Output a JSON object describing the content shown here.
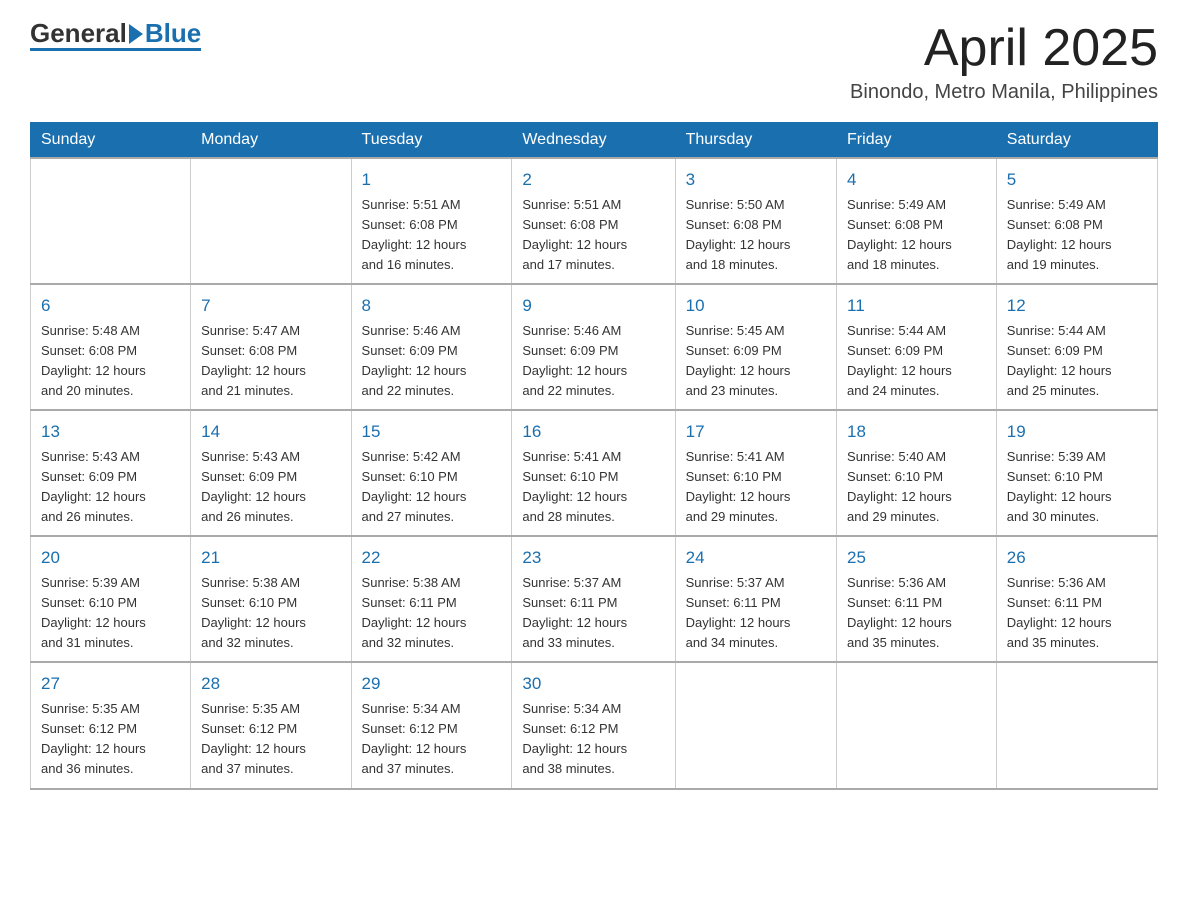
{
  "header": {
    "logo_general": "General",
    "logo_blue": "Blue",
    "title": "April 2025",
    "subtitle": "Binondo, Metro Manila, Philippines"
  },
  "weekdays": [
    "Sunday",
    "Monday",
    "Tuesday",
    "Wednesday",
    "Thursday",
    "Friday",
    "Saturday"
  ],
  "weeks": [
    [
      {
        "day": "",
        "detail": ""
      },
      {
        "day": "",
        "detail": ""
      },
      {
        "day": "1",
        "detail": "Sunrise: 5:51 AM\nSunset: 6:08 PM\nDaylight: 12 hours\nand 16 minutes."
      },
      {
        "day": "2",
        "detail": "Sunrise: 5:51 AM\nSunset: 6:08 PM\nDaylight: 12 hours\nand 17 minutes."
      },
      {
        "day": "3",
        "detail": "Sunrise: 5:50 AM\nSunset: 6:08 PM\nDaylight: 12 hours\nand 18 minutes."
      },
      {
        "day": "4",
        "detail": "Sunrise: 5:49 AM\nSunset: 6:08 PM\nDaylight: 12 hours\nand 18 minutes."
      },
      {
        "day": "5",
        "detail": "Sunrise: 5:49 AM\nSunset: 6:08 PM\nDaylight: 12 hours\nand 19 minutes."
      }
    ],
    [
      {
        "day": "6",
        "detail": "Sunrise: 5:48 AM\nSunset: 6:08 PM\nDaylight: 12 hours\nand 20 minutes."
      },
      {
        "day": "7",
        "detail": "Sunrise: 5:47 AM\nSunset: 6:08 PM\nDaylight: 12 hours\nand 21 minutes."
      },
      {
        "day": "8",
        "detail": "Sunrise: 5:46 AM\nSunset: 6:09 PM\nDaylight: 12 hours\nand 22 minutes."
      },
      {
        "day": "9",
        "detail": "Sunrise: 5:46 AM\nSunset: 6:09 PM\nDaylight: 12 hours\nand 22 minutes."
      },
      {
        "day": "10",
        "detail": "Sunrise: 5:45 AM\nSunset: 6:09 PM\nDaylight: 12 hours\nand 23 minutes."
      },
      {
        "day": "11",
        "detail": "Sunrise: 5:44 AM\nSunset: 6:09 PM\nDaylight: 12 hours\nand 24 minutes."
      },
      {
        "day": "12",
        "detail": "Sunrise: 5:44 AM\nSunset: 6:09 PM\nDaylight: 12 hours\nand 25 minutes."
      }
    ],
    [
      {
        "day": "13",
        "detail": "Sunrise: 5:43 AM\nSunset: 6:09 PM\nDaylight: 12 hours\nand 26 minutes."
      },
      {
        "day": "14",
        "detail": "Sunrise: 5:43 AM\nSunset: 6:09 PM\nDaylight: 12 hours\nand 26 minutes."
      },
      {
        "day": "15",
        "detail": "Sunrise: 5:42 AM\nSunset: 6:10 PM\nDaylight: 12 hours\nand 27 minutes."
      },
      {
        "day": "16",
        "detail": "Sunrise: 5:41 AM\nSunset: 6:10 PM\nDaylight: 12 hours\nand 28 minutes."
      },
      {
        "day": "17",
        "detail": "Sunrise: 5:41 AM\nSunset: 6:10 PM\nDaylight: 12 hours\nand 29 minutes."
      },
      {
        "day": "18",
        "detail": "Sunrise: 5:40 AM\nSunset: 6:10 PM\nDaylight: 12 hours\nand 29 minutes."
      },
      {
        "day": "19",
        "detail": "Sunrise: 5:39 AM\nSunset: 6:10 PM\nDaylight: 12 hours\nand 30 minutes."
      }
    ],
    [
      {
        "day": "20",
        "detail": "Sunrise: 5:39 AM\nSunset: 6:10 PM\nDaylight: 12 hours\nand 31 minutes."
      },
      {
        "day": "21",
        "detail": "Sunrise: 5:38 AM\nSunset: 6:10 PM\nDaylight: 12 hours\nand 32 minutes."
      },
      {
        "day": "22",
        "detail": "Sunrise: 5:38 AM\nSunset: 6:11 PM\nDaylight: 12 hours\nand 32 minutes."
      },
      {
        "day": "23",
        "detail": "Sunrise: 5:37 AM\nSunset: 6:11 PM\nDaylight: 12 hours\nand 33 minutes."
      },
      {
        "day": "24",
        "detail": "Sunrise: 5:37 AM\nSunset: 6:11 PM\nDaylight: 12 hours\nand 34 minutes."
      },
      {
        "day": "25",
        "detail": "Sunrise: 5:36 AM\nSunset: 6:11 PM\nDaylight: 12 hours\nand 35 minutes."
      },
      {
        "day": "26",
        "detail": "Sunrise: 5:36 AM\nSunset: 6:11 PM\nDaylight: 12 hours\nand 35 minutes."
      }
    ],
    [
      {
        "day": "27",
        "detail": "Sunrise: 5:35 AM\nSunset: 6:12 PM\nDaylight: 12 hours\nand 36 minutes."
      },
      {
        "day": "28",
        "detail": "Sunrise: 5:35 AM\nSunset: 6:12 PM\nDaylight: 12 hours\nand 37 minutes."
      },
      {
        "day": "29",
        "detail": "Sunrise: 5:34 AM\nSunset: 6:12 PM\nDaylight: 12 hours\nand 37 minutes."
      },
      {
        "day": "30",
        "detail": "Sunrise: 5:34 AM\nSunset: 6:12 PM\nDaylight: 12 hours\nand 38 minutes."
      },
      {
        "day": "",
        "detail": ""
      },
      {
        "day": "",
        "detail": ""
      },
      {
        "day": "",
        "detail": ""
      }
    ]
  ]
}
